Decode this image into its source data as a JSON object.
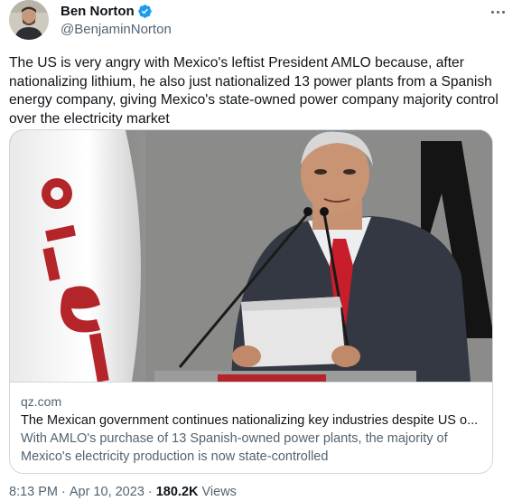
{
  "author": {
    "display_name": "Ben Norton",
    "handle": "@BenjaminNorton",
    "verified": true
  },
  "tweet": {
    "text": "The US is very angry with Mexico's leftist President AMLO because, after nationalizing lithium, he also just nationalized 13 power plants from a Spanish energy company, giving Mexico's state-owned power company majority control over the electricity market"
  },
  "link_card": {
    "domain": "qz.com",
    "title": "The Mexican government continues nationalizing key industries despite US o...",
    "description": "With AMLO's purchase of 13 Spanish-owned power plants, the majority of Mexico's electricity production is now state-controlled"
  },
  "footer": {
    "time": "8:13 PM",
    "separator": "·",
    "date": "Apr 10, 2023",
    "views_count": "180.2K",
    "views_label": "Views"
  },
  "colors": {
    "text_primary": "#0f1419",
    "text_secondary": "#536471",
    "verified_badge": "#1d9bf0",
    "border": "#cfd9de",
    "flag_red": "#c0392b"
  },
  "icons": {
    "verified": "verified-badge-icon",
    "more": "more-options-icon"
  }
}
